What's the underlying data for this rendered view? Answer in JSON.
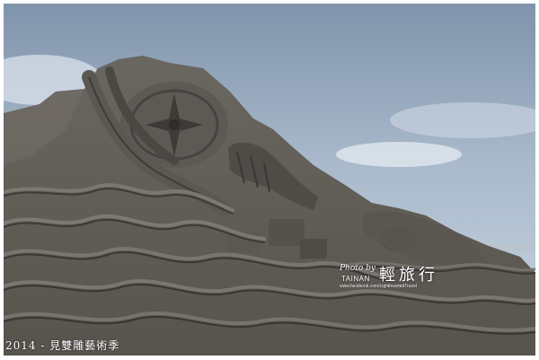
{
  "caption": "2014 - 見雙雕藝術季",
  "watermark": {
    "photo_by": "Photo by",
    "city": "TAINAN",
    "brand": "輕旅行",
    "url": "www.facebook.com/LightheartedTravel"
  },
  "colors": {
    "sky": "#9fb1c6",
    "sand": "#6f6b65",
    "frame": "#ffffff"
  }
}
